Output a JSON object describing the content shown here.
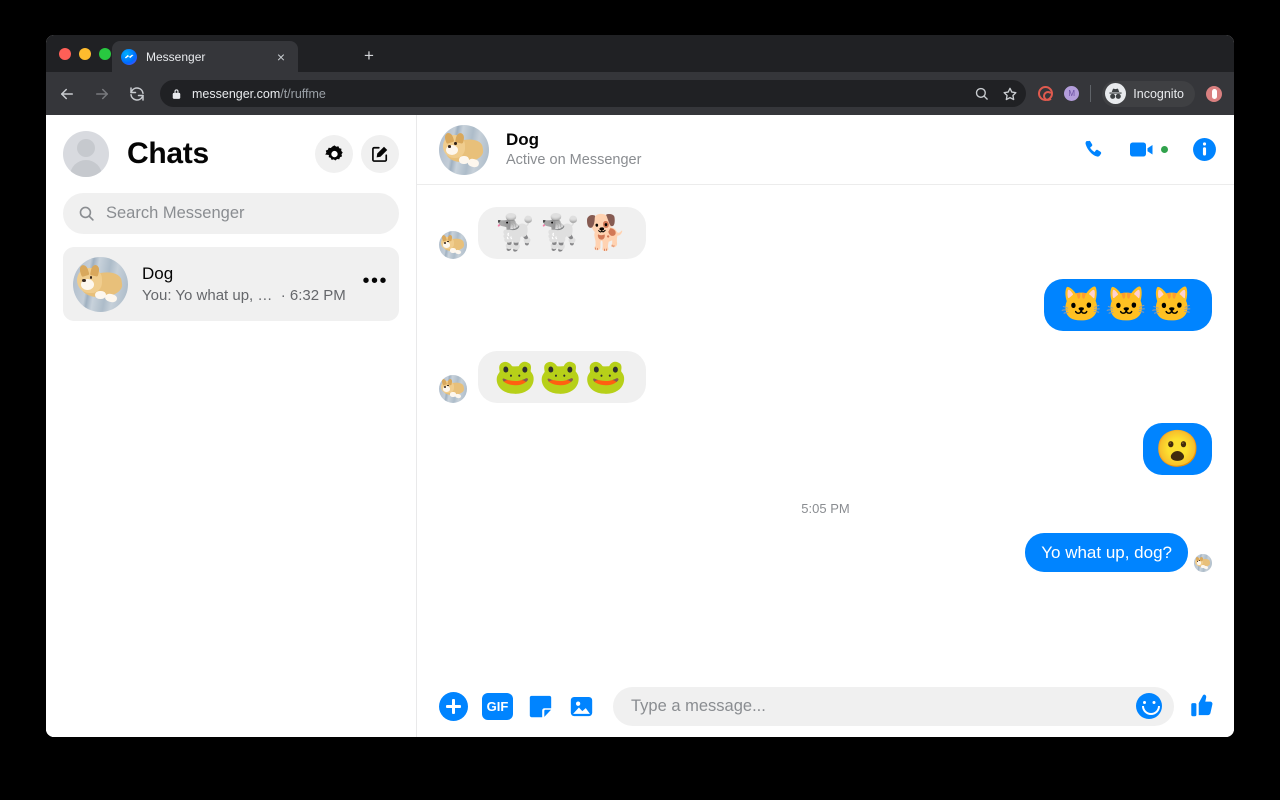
{
  "browser": {
    "tab": {
      "title": "Messenger",
      "favicon": "messenger-icon",
      "close": "×"
    },
    "new_tab": "+",
    "nav": {
      "back": "back-arrow",
      "forward": "forward-arrow",
      "reload": "reload-icon"
    },
    "address": {
      "host": "messenger.com",
      "path": "/t/ruffme",
      "lock": "lock-icon"
    },
    "toolbar": {
      "search": "search-icon",
      "bookmark": "star-icon",
      "extension_swirl": "swirl-extension-icon",
      "extension_purple": "M",
      "incognito_label": "Incognito",
      "profile": "profile-icon"
    }
  },
  "sidebar": {
    "title": "Chats",
    "avatar": "user-avatar-placeholder",
    "settings_icon": "gear-icon",
    "compose_icon": "compose-icon",
    "search": {
      "placeholder": "Search Messenger",
      "value": "",
      "icon": "search-icon"
    },
    "threads": [
      {
        "name": "Dog",
        "preview": "You: Yo what up, …",
        "time": "· 6:32 PM",
        "menu": "•••",
        "avatar": "corgi-avatar",
        "selected": true
      }
    ]
  },
  "conversation": {
    "name": "Dog",
    "status": "Active on Messenger",
    "avatar": "corgi-avatar",
    "actions": {
      "call": "phone-icon",
      "video": "video-camera-icon",
      "video_active": true,
      "info": "info-icon"
    },
    "messages": [
      {
        "side": "in",
        "type": "emoji",
        "text": "🐩🐩🐕",
        "avatar": "corgi-avatar"
      },
      {
        "side": "out",
        "type": "emoji",
        "text": "🐱🐱🐱"
      },
      {
        "side": "in",
        "type": "emoji",
        "text": "🐸🐸🐸",
        "avatar": "corgi-avatar"
      },
      {
        "side": "out",
        "type": "emoji-lg",
        "text": "😮"
      }
    ],
    "time_divider": "5:05 PM",
    "last_message": {
      "side": "out",
      "type": "text",
      "text": "Yo what up, dog?",
      "receipt": "corgi-avatar"
    }
  },
  "composer": {
    "add": "plus-icon",
    "gif": "GIF",
    "sticker": "sticker-icon",
    "photo": "photo-icon",
    "input": {
      "placeholder": "Type a message...",
      "value": ""
    },
    "emoji": "smiley-icon",
    "like": "thumbs-up-icon"
  },
  "colors": {
    "accent": "#0084ff",
    "bubble_in": "#f0f0f0",
    "chrome_dark": "#35363a",
    "online": "#31a24c"
  }
}
